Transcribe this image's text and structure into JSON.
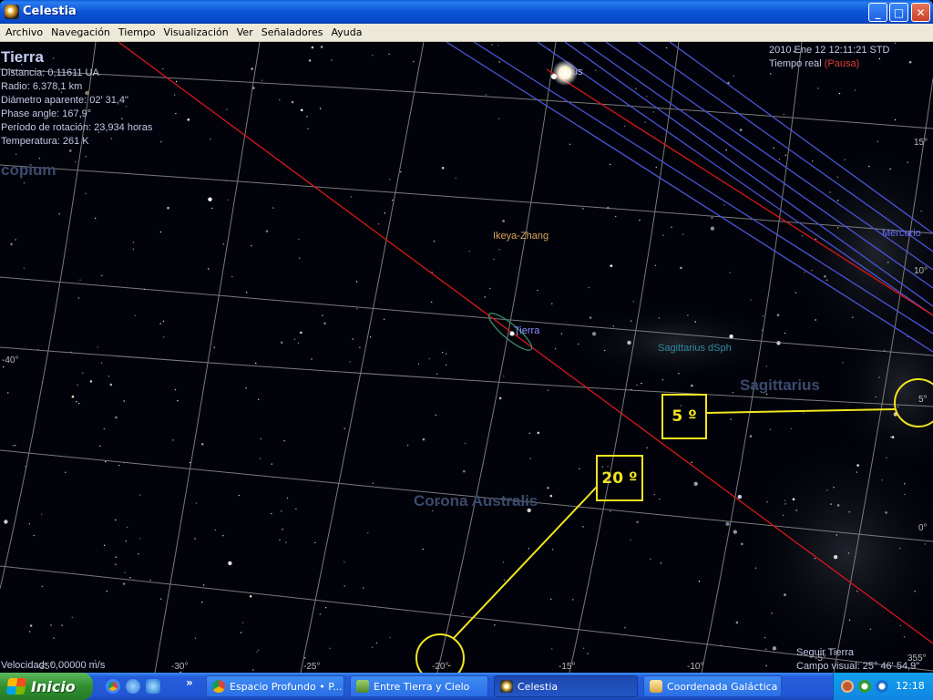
{
  "window": {
    "title": "Celestia",
    "controls": {
      "minimize": "_",
      "maximize": "□",
      "close": "✕"
    }
  },
  "menu": [
    "Archivo",
    "Navegación",
    "Tiempo",
    "Visualización",
    "Ver",
    "Señaladores",
    "Ayuda"
  ],
  "info": {
    "object_name": "Tierra",
    "lines": [
      "Distancia: 0,11611 UA",
      "Radio: 6.378,1 km",
      "Diámetro aparente: 02' 31,4\"",
      "Phase angle: 167,9°",
      "Período de rotación: 23,934 horas",
      "Temperatura: 261 K"
    ]
  },
  "time": {
    "datetime": "2010 Ene 12 12:11:21 STD",
    "mode": "Tiempo real",
    "paused": "(Pausa)"
  },
  "bottom": {
    "velocity": "Velocidad: 0,00000 m/s",
    "follow": "Seguir Tierra",
    "fov": "Campo visual: 25° 46' 54,9\""
  },
  "constellations": [
    {
      "name": "copium"
    },
    {
      "name": "Sagittarius"
    },
    {
      "name": "Corona Australis"
    }
  ],
  "objects": [
    {
      "name": "Ikeya-Zhang",
      "color": "#d9a35a"
    },
    {
      "name": "Tierra",
      "color": "#8a8cff"
    },
    {
      "name": "Sagittarius dSph",
      "color": "#2f8aa3"
    },
    {
      "name": "Mercurio",
      "color": "#6c6cff"
    },
    {
      "name": "us",
      "color": "#b8b8ff"
    }
  ],
  "grid_labels": {
    "dec": [
      "15°",
      "10°",
      "5°",
      "0°",
      "-40°"
    ],
    "ra": [
      "-35°",
      "-30°",
      "-25°",
      "-20°",
      "-15°",
      "-10°",
      "-5°",
      "355°"
    ]
  },
  "annotations": [
    {
      "label": "5 º"
    },
    {
      "label": "20 º"
    }
  ],
  "colors": {
    "ecliptic": "#d81818",
    "orbits": "#4a55d8",
    "grid": "#8f8f8f",
    "annotation": "#f2e51e"
  },
  "taskbar": {
    "start_label": "Inicio",
    "quick_launch": [
      "chrome-icon",
      "globe-icon",
      "ie-icon"
    ],
    "overflow": "»",
    "tasks": [
      {
        "label": "Espacio Profundo • P...",
        "active": false
      },
      {
        "label": "Entre Tierra y Cielo",
        "active": false
      },
      {
        "label": "Celestia",
        "active": true
      },
      {
        "label": "Coordenada Galáctica ...",
        "active": false
      }
    ],
    "clock": "12:18"
  }
}
